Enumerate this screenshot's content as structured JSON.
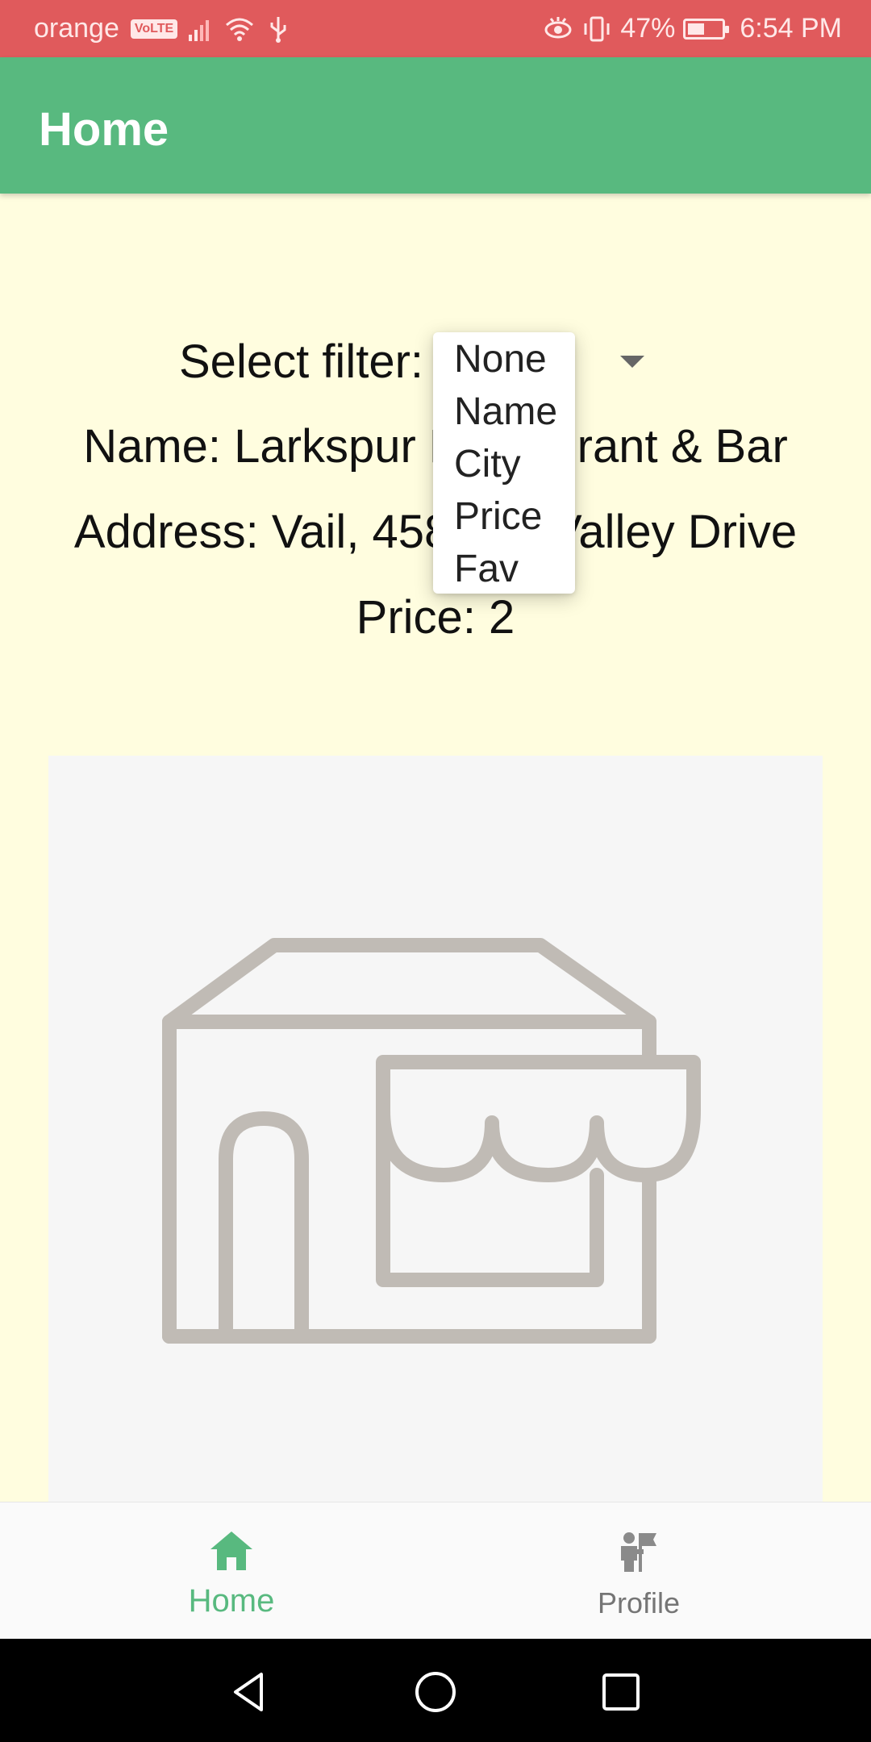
{
  "status_bar": {
    "carrier": "orange",
    "volte": "VoLTE",
    "battery": "47%",
    "time": "6:54 PM",
    "icons": [
      "signal-icon",
      "wifi-icon",
      "usb-icon",
      "eye-icon",
      "vibrate-icon",
      "battery-icon"
    ]
  },
  "app_bar": {
    "title": "Home"
  },
  "filter": {
    "label": "Select filter:",
    "options": [
      "None",
      "Name",
      "City",
      "Price",
      "Fav"
    ]
  },
  "restaurant": {
    "name_line": "Name: Larkspur Restaurant & Bar",
    "address_line": "Address: Vail, 458 Vail Valley Drive",
    "price_line": "Price: 2",
    "image_icon": "storefront-icon"
  },
  "bottom_nav": {
    "home_label": "Home",
    "profile_label": "Profile",
    "active": "Home",
    "active_color": "#58b97f"
  },
  "colors": {
    "status_bar": "#e05a5c",
    "app_bar": "#58b97f",
    "background": "#fffddf"
  }
}
